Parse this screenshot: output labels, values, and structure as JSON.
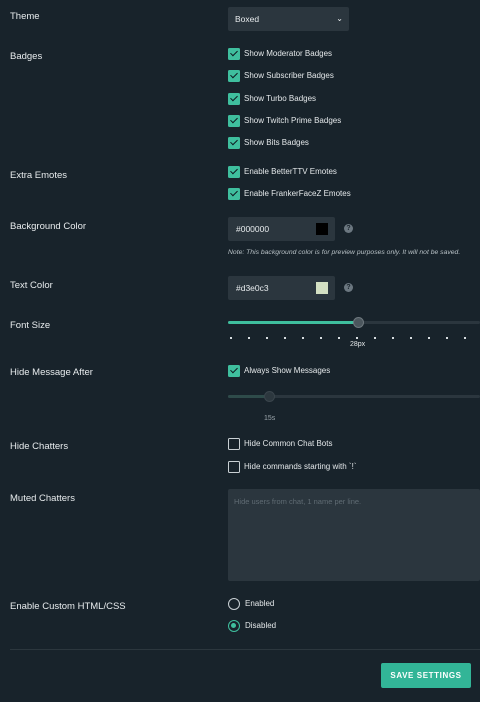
{
  "theme": {
    "label": "Theme",
    "value": "Boxed",
    "chevron": "⌄"
  },
  "badges": {
    "label": "Badges",
    "options": [
      {
        "label": "Show Moderator Badges",
        "checked": true
      },
      {
        "label": "Show Subscriber Badges",
        "checked": true
      },
      {
        "label": "Show Turbo Badges",
        "checked": true
      },
      {
        "label": "Show Twitch Prime Badges",
        "checked": true
      },
      {
        "label": "Show Bits Badges",
        "checked": true
      }
    ]
  },
  "extra_emotes": {
    "label": "Extra Emotes",
    "options": [
      {
        "label": "Enable BetterTTV Emotes",
        "checked": true
      },
      {
        "label": "Enable FrankerFaceZ Emotes",
        "checked": true
      }
    ]
  },
  "background_color": {
    "label": "Background Color",
    "value": "#000000",
    "swatch": "#000000",
    "help": "?",
    "note": "Note: This background color is for preview purposes only. It will not be saved."
  },
  "text_color": {
    "label": "Text Color",
    "value": "#d3e0c3",
    "swatch": "#d3e0c3",
    "help": "?"
  },
  "font_size": {
    "label": "Font Size",
    "value_label": "28px",
    "fraction": 0.52
  },
  "hide_message_after": {
    "label": "Hide Message After",
    "checkbox_label": "Always Show Messages",
    "checked": true,
    "value_label": "15s",
    "fraction": 0.16
  },
  "hide_chatters": {
    "label": "Hide Chatters",
    "options": [
      {
        "label": "Hide Common Chat Bots",
        "checked": false
      },
      {
        "label": "Hide commands starting with `!`",
        "checked": false
      }
    ]
  },
  "muted_chatters": {
    "label": "Muted Chatters",
    "placeholder": "Hide users from chat, 1 name per line."
  },
  "custom_html": {
    "label": "Enable Custom HTML/CSS",
    "options": [
      {
        "label": "Enabled",
        "selected": false
      },
      {
        "label": "Disabled",
        "selected": true
      }
    ]
  },
  "save_button": {
    "label": "SAVE SETTINGS"
  },
  "colors": {
    "accent": "#3fbf9e",
    "background": "#18232b",
    "field": "#2b363e"
  }
}
